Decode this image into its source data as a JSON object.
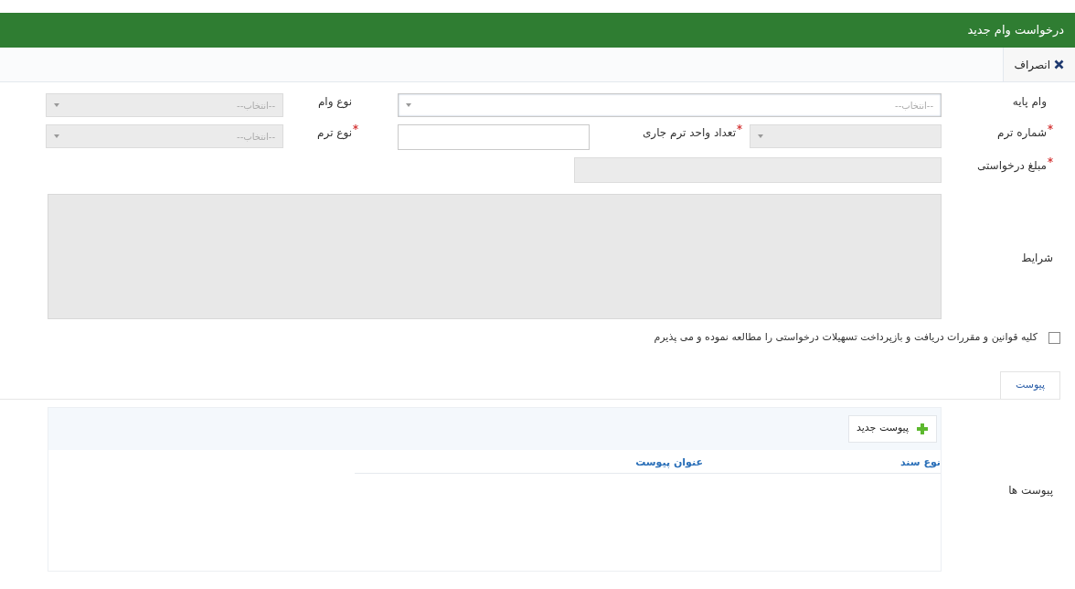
{
  "header": {
    "title": "درخواست وام جدید"
  },
  "toolbar": {
    "cancel": "انصراف"
  },
  "rows": [
    {
      "fields": [
        {
          "kind": "select",
          "label": "وام پایه",
          "required": false,
          "disabled": false,
          "placeholder": "--انتخاب--"
        },
        {
          "kind": "select",
          "label": "نوع وام",
          "required": false,
          "disabled": true,
          "placeholder": "--انتخاب--"
        }
      ]
    },
    {
      "fields": [
        {
          "kind": "select",
          "label": "شماره ترم",
          "required": true,
          "disabled": true
        },
        {
          "kind": "input",
          "label": "تعداد واحد ترم جاری",
          "required": true,
          "disabled": false
        },
        {
          "kind": "select",
          "label": "نوع ترم",
          "required": true,
          "disabled": true,
          "placeholder": "--انتخاب--"
        }
      ]
    },
    {
      "fields": [
        {
          "kind": "input",
          "label": "مبلغ درخواستی",
          "required": true,
          "disabled": true
        }
      ]
    }
  ],
  "conditions": {
    "label": "شرایط",
    "disabled": true
  },
  "agreement": {
    "text": "کلیه قوانین و مقررات دریافت و بازپرداخت تسهیلات درخواستی را مطالعه نموده و می پذیرم",
    "checked": false
  },
  "tabs": [
    {
      "label": "پیوست",
      "selected": true
    }
  ],
  "attachments": {
    "label": "پیوست ها",
    "add_button": "پیوست جدید",
    "columns": [
      "نوع سند",
      "عنوان پیوست"
    ]
  }
}
